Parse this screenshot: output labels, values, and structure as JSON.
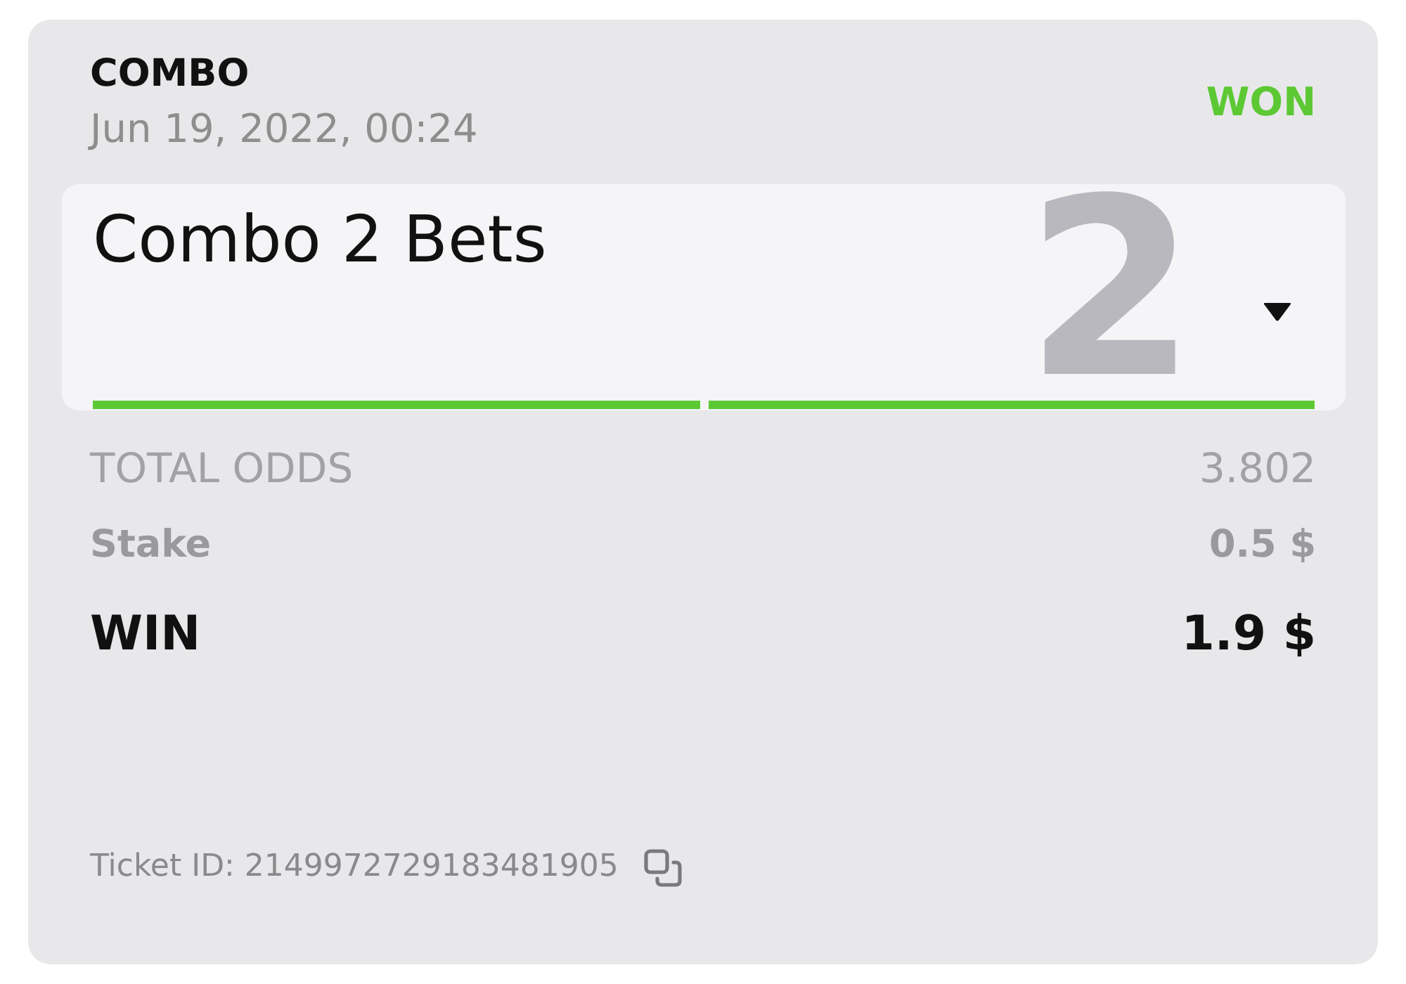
{
  "bet": {
    "type": "COMBO",
    "date": "Jun 19, 2022, 00:24",
    "status": "WON",
    "won": true
  },
  "selection_panel": {
    "title": "Combo 2 Bets",
    "count": "2",
    "expanded": false,
    "legs": [
      {
        "won": true
      },
      {
        "won": true
      }
    ]
  },
  "summary": [
    {
      "kind": "odds",
      "label": "TOTAL ODDS",
      "value": "3.802"
    },
    {
      "kind": "stake",
      "label": "Stake",
      "value": "0.5 $"
    },
    {
      "kind": "win",
      "label": "WIN",
      "value": "1.9 $"
    }
  ],
  "ticket": {
    "text": "Ticket ID: 2149972729183481905"
  }
}
